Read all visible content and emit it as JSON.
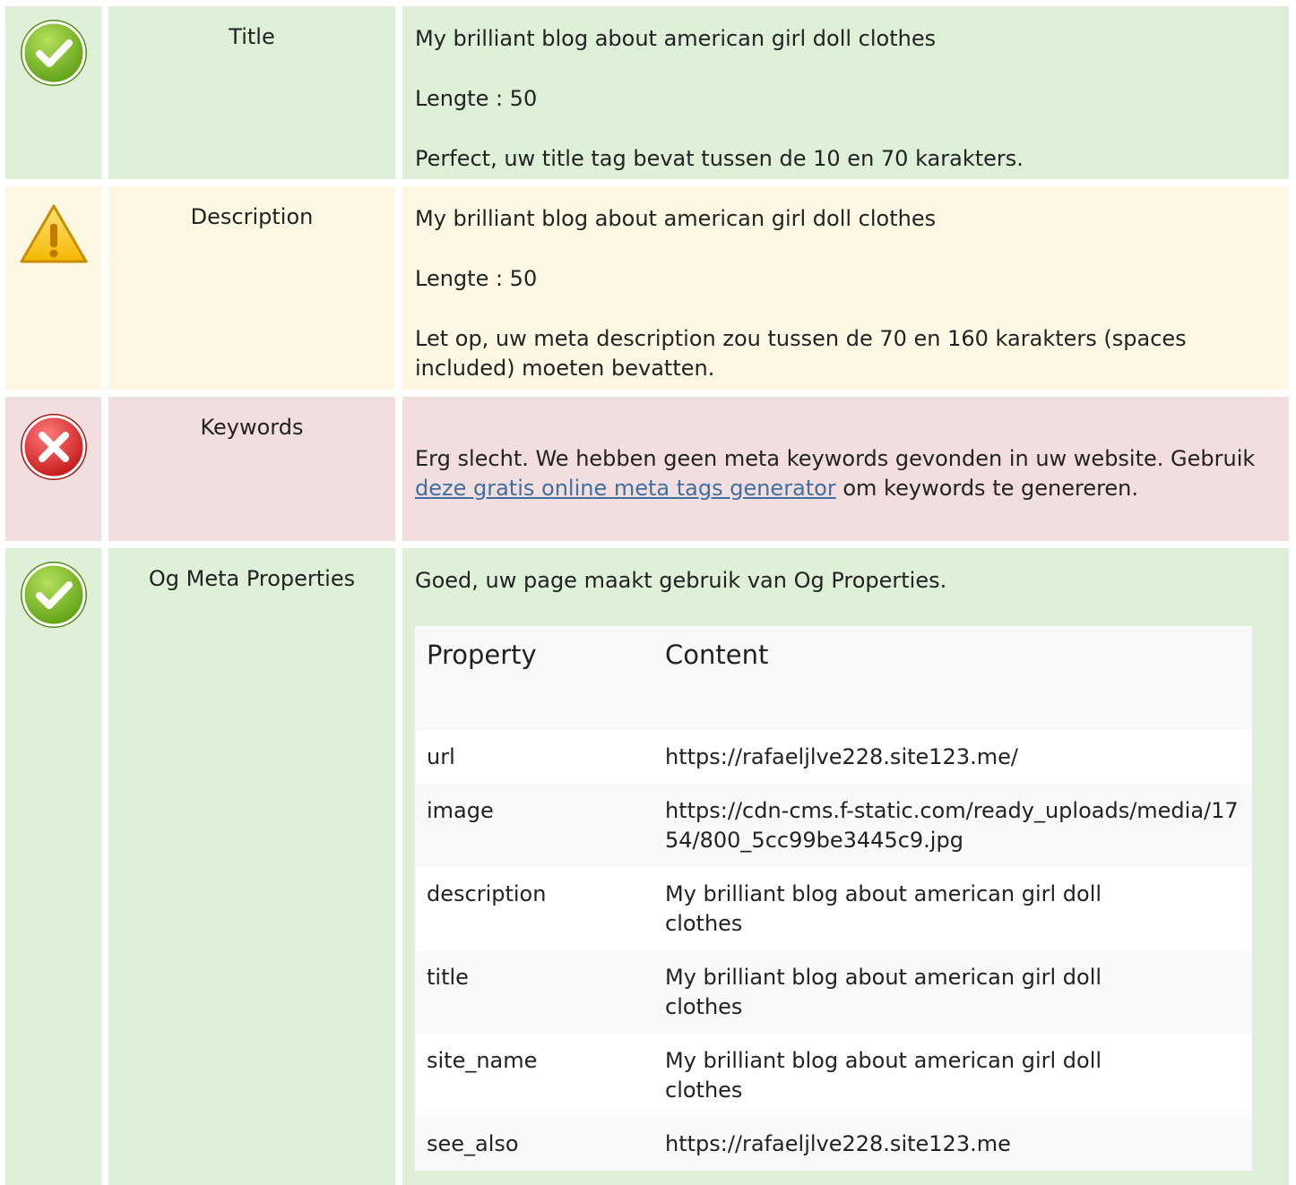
{
  "rows": {
    "title": {
      "status": "ok",
      "label": "Title",
      "value": "My brilliant blog about american girl doll clothes",
      "length": "Lengte : 50",
      "message": "Perfect, uw title tag bevat tussen de 10 en 70 karakters."
    },
    "description": {
      "status": "warning",
      "label": "Description",
      "value": "My brilliant blog about american girl doll clothes",
      "length": "Lengte : 50",
      "message": "Let op, uw meta description zou tussen de 70 en 160 karakters (spaces included) moeten bevatten."
    },
    "keywords": {
      "status": "error",
      "label": "Keywords",
      "message_before": "Erg slecht. We hebben geen meta keywords gevonden in uw website. Gebruik ",
      "link_text": "deze gratis online meta tags generator",
      "message_after": " om keywords te genereren."
    },
    "og": {
      "status": "ok",
      "label": "Og Meta Properties",
      "message": "Goed, uw page maakt gebruik van Og Properties.",
      "table": {
        "headers": [
          "Property",
          "Content"
        ],
        "rows": [
          [
            "url",
            "https://rafaeljlve228.site123.me/"
          ],
          [
            "image",
            "https://cdn-cms.f-static.com/ready_uploads/media/1754/800_5cc99be3445c9.jpg"
          ],
          [
            "description",
            "My brilliant blog about american girl doll clothes"
          ],
          [
            "title",
            "My brilliant blog about american girl doll clothes"
          ],
          [
            "site_name",
            "My brilliant blog about american girl doll clothes"
          ],
          [
            "see_also",
            "https://rafaeljlve228.site123.me"
          ]
        ]
      }
    }
  },
  "colors": {
    "ok_bg": "#dff0d8",
    "warning_bg": "#fcf8e3",
    "error_bg": "#f2dede",
    "link": "#3f6f9f"
  }
}
